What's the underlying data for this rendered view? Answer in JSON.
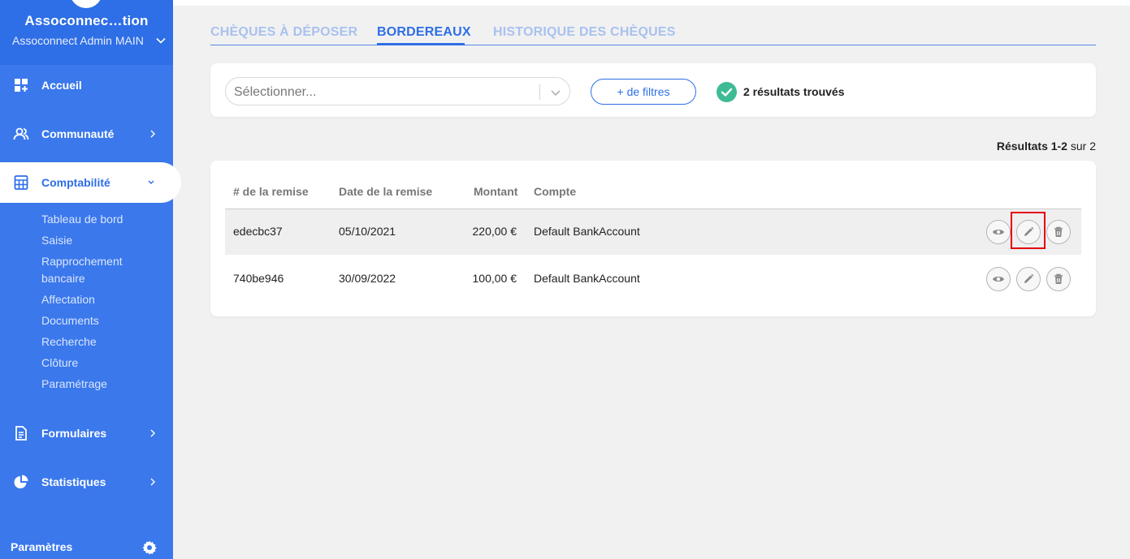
{
  "sidebar": {
    "org_name": "Assoconnec…tion",
    "account": "Assoconnect Admin MAIN",
    "items": [
      {
        "label": "Accueil",
        "icon": "dashboard-icon"
      },
      {
        "label": "Communauté",
        "icon": "users-icon"
      },
      {
        "label": "Comptabilité",
        "icon": "calculator-icon"
      },
      {
        "label": "Formulaires",
        "icon": "document-icon"
      },
      {
        "label": "Statistiques",
        "icon": "pie-chart-icon"
      }
    ],
    "sub_items": [
      "Tableau de bord",
      "Saisie",
      "Rapprochement",
      "bancaire",
      "Affectation",
      "Documents",
      "Recherche",
      "Clôture",
      "Paramétrage"
    ],
    "footer_label": "Paramètres"
  },
  "tabs": [
    {
      "label": "CHÈQUES À DÉPOSER",
      "active": false
    },
    {
      "label": "BORDEREAUX",
      "active": true
    },
    {
      "label": "HISTORIQUE DES CHÈQUES",
      "active": false
    }
  ],
  "filters": {
    "select_placeholder": "Sélectionner...",
    "more_filters_label": "+ de filtres",
    "results_found": "2 résultats trouvés"
  },
  "results_range": {
    "prefix": "Résultats 1-2",
    "suffix": "sur 2"
  },
  "table": {
    "columns": [
      "# de la remise",
      "Date de la remise",
      "Montant",
      "Compte"
    ],
    "rows": [
      {
        "id": "edecbc37",
        "date": "05/10/2021",
        "amount": "220,00 €",
        "account": "Default BankAccount"
      },
      {
        "id": "740be946",
        "date": "30/09/2022",
        "amount": "100,00 €",
        "account": "Default BankAccount"
      }
    ]
  },
  "colors": {
    "sidebar": "#3a78ec",
    "accent": "#2e6ee6",
    "success": "#3dbb95",
    "highlight": "#e3000f"
  }
}
